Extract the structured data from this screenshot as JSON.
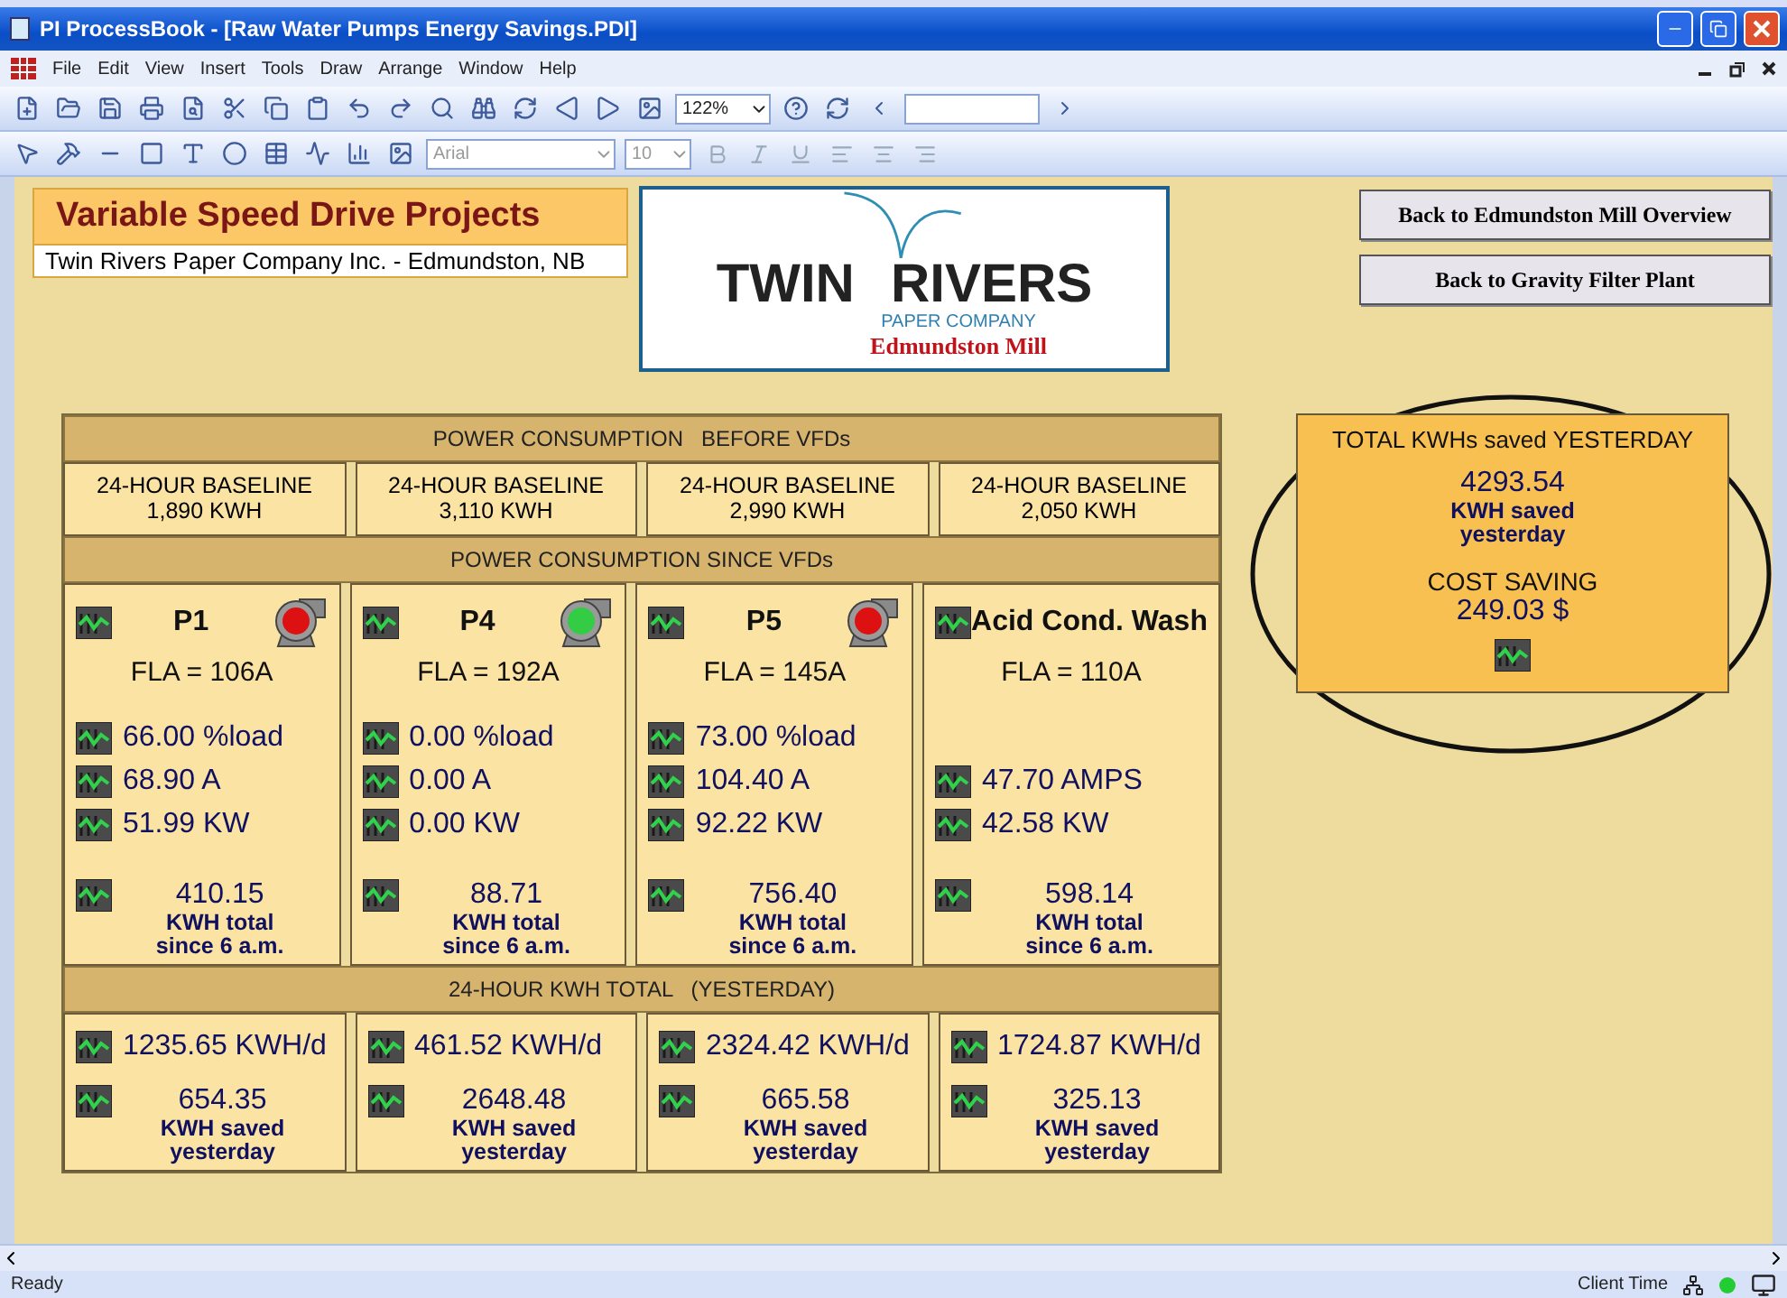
{
  "window": {
    "title": "PI ProcessBook - [Raw Water Pumps Energy Savings.PDI]"
  },
  "menu": [
    "File",
    "Edit",
    "View",
    "Insert",
    "Tools",
    "Draw",
    "Arrange",
    "Window",
    "Help"
  ],
  "toolbar": {
    "zoom": "122%",
    "font": "Arial",
    "font_size": "10"
  },
  "header": {
    "title": "Variable Speed Drive Projects",
    "subtitle": "Twin Rivers Paper Company Inc. - Edmundston, NB"
  },
  "logo": {
    "name_left": "TWIN",
    "name_right": "RIVERS",
    "tagline": "PAPER COMPANY",
    "site": "Edmundston Mill"
  },
  "nav_buttons": [
    "Back to Edmundston Mill Overview",
    "Back to Gravity Filter Plant"
  ],
  "table": {
    "before_heading": "POWER CONSUMPTION   BEFORE VFDs",
    "since_heading": "POWER CONSUMPTION SINCE VFDs",
    "yesterday_heading": "24-HOUR KWH TOTAL   (YESTERDAY)",
    "baselines": [
      {
        "label": "24-HOUR BASELINE",
        "value": "1,890 KWH"
      },
      {
        "label": "24-HOUR BASELINE",
        "value": "3,110 KWH"
      },
      {
        "label": "24-HOUR BASELINE",
        "value": "2,990 KWH"
      },
      {
        "label": "24-HOUR BASELINE",
        "value": "2,050 KWH"
      }
    ],
    "pumps": [
      {
        "name": "P1",
        "on": false,
        "fla": "FLA = 106A",
        "load": "66.00 %load",
        "amps": "68.90 A",
        "kw": "51.99 KW",
        "total": "410.15",
        "total_label": [
          "KWH total",
          "since 6 a.m."
        ]
      },
      {
        "name": "P4",
        "on": true,
        "fla": "FLA = 192A",
        "load": "0.00 %load",
        "amps": "0.00 A",
        "kw": "0.00 KW",
        "total": "88.71",
        "total_label": [
          "KWH total",
          "since 6 a.m."
        ]
      },
      {
        "name": "P5",
        "on": false,
        "fla": "FLA = 145A",
        "load": "73.00 %load",
        "amps": "104.40 A",
        "kw": "92.22 KW",
        "total": "756.40",
        "total_label": [
          "KWH total",
          "since 6 a.m."
        ]
      },
      {
        "name": "Acid Cond. Wash",
        "fla": "FLA = 110A",
        "amps": "47.70 AMPS",
        "kw": "42.58 KW",
        "total": "598.14",
        "total_label": [
          "KWH total",
          "since 6 a.m."
        ]
      }
    ],
    "yesterday": [
      {
        "kwh": "1235.65 KWH/d",
        "saved": "654.35",
        "saved_label": [
          "KWH saved",
          "yesterday"
        ]
      },
      {
        "kwh": "461.52 KWH/d",
        "saved": "2648.48",
        "saved_label": [
          "KWH saved",
          "yesterday"
        ]
      },
      {
        "kwh": "2324.42 KWH/d",
        "saved": "665.58",
        "saved_label": [
          "KWH saved",
          "yesterday"
        ]
      },
      {
        "kwh": "1724.87 KWH/d",
        "saved": "325.13",
        "saved_label": [
          "KWH saved",
          "yesterday"
        ]
      }
    ]
  },
  "totals": {
    "title": "TOTAL KWHs saved YESTERDAY",
    "kwh": "4293.54",
    "kwh_label": [
      "KWH saved",
      "yesterday"
    ],
    "cost_label": "COST SAVING",
    "cost": "249.03 $"
  },
  "status_bar": {
    "left": "Ready",
    "right": "Client Time"
  }
}
